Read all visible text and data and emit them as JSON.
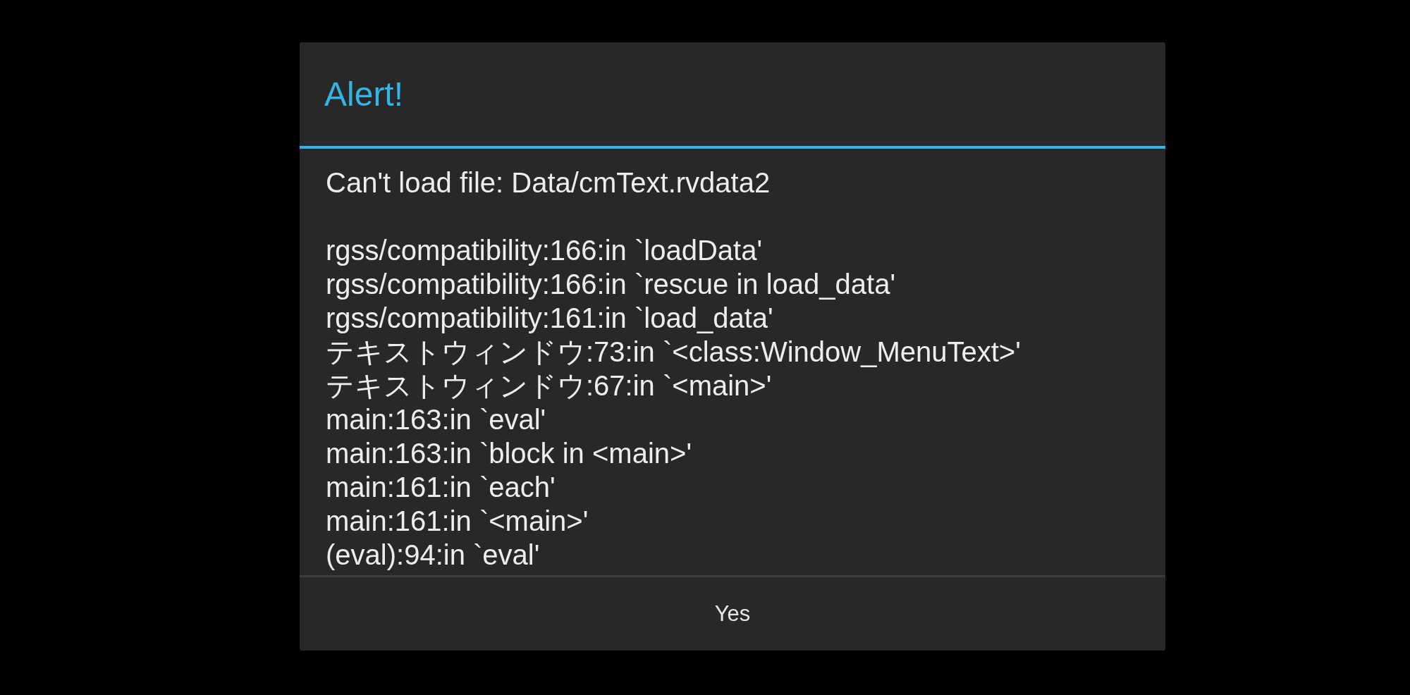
{
  "dialog": {
    "title": "Alert!",
    "message": "Can't load file: Data/cmText.rvdata2",
    "trace": [
      "rgss/compatibility:166:in `loadData'",
      "rgss/compatibility:166:in `rescue in load_data'",
      "rgss/compatibility:161:in `load_data'",
      "テキストウィンドウ:73:in `<class:Window_MenuText>'",
      "テキストウィンドウ:67:in `<main>'",
      "main:163:in `eval'",
      "main:163:in `block in <main>'",
      "main:161:in `each'",
      "main:161:in `<main>'",
      "(eval):94:in `eval'"
    ],
    "buttons": [
      "Yes"
    ]
  }
}
